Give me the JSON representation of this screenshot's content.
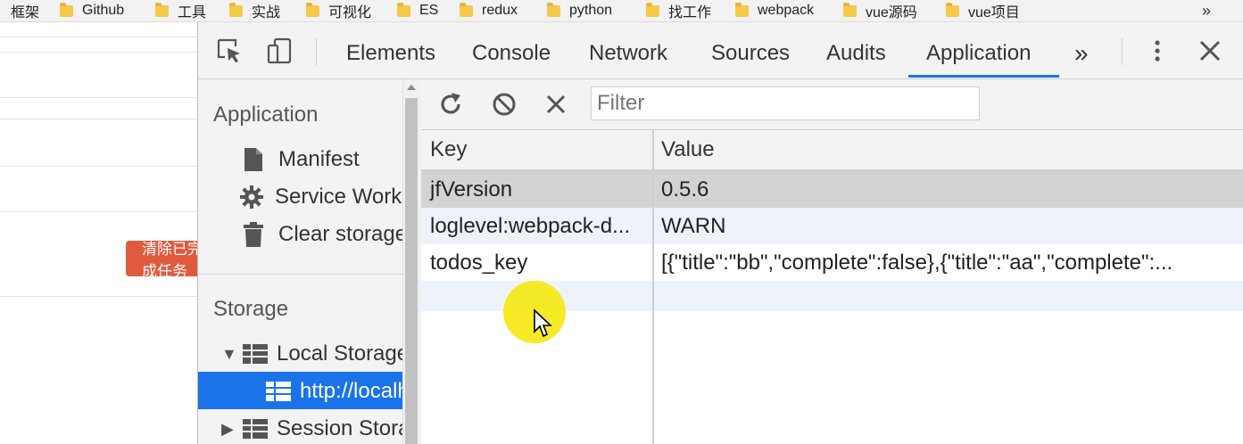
{
  "bookmarks": {
    "items": [
      {
        "label": "框架",
        "folder": false
      },
      {
        "label": "Github",
        "folder": true
      },
      {
        "label": "工具",
        "folder": true
      },
      {
        "label": "实战",
        "folder": true
      },
      {
        "label": "可视化",
        "folder": true
      },
      {
        "label": "ES",
        "folder": true
      },
      {
        "label": "redux",
        "folder": true
      },
      {
        "label": "python",
        "folder": true
      },
      {
        "label": "找工作",
        "folder": true
      },
      {
        "label": "webpack",
        "folder": true
      },
      {
        "label": "vue源码",
        "folder": true
      },
      {
        "label": "vue项目",
        "folder": true
      }
    ],
    "more": "»"
  },
  "page": {
    "button_label": "清除已完成任务"
  },
  "devtools": {
    "tabs": [
      "Elements",
      "Console",
      "Network",
      "Sources",
      "Audits",
      "Application"
    ],
    "active_tab": "Application",
    "overflow": "»",
    "menu_icon": "kebab-menu-icon",
    "close_icon": "close-icon",
    "accent": "#1a73e8"
  },
  "sidebar": {
    "application_section": "Application",
    "application_items": [
      {
        "label": "Manifest",
        "icon": "file-icon"
      },
      {
        "label": "Service Workers",
        "icon": "gear-icon"
      },
      {
        "label": "Clear storage",
        "icon": "trash-icon"
      }
    ],
    "storage_section": "Storage",
    "storage_items": [
      {
        "label": "Local Storage",
        "icon": "grid-icon",
        "expanded": true
      },
      {
        "label": "http://localhost",
        "icon": "grid-icon",
        "selected": true
      },
      {
        "label": "Session Storage",
        "icon": "grid-icon",
        "expanded": false
      }
    ]
  },
  "storage_view": {
    "filter_placeholder": "Filter",
    "columns": [
      "Key",
      "Value"
    ],
    "rows": [
      {
        "key": "jfVersion",
        "value": "0.5.6",
        "selected": true
      },
      {
        "key": "loglevel:webpack-d...",
        "value": "WARN"
      },
      {
        "key": "todos_key",
        "value": "[{\"title\":\"bb\",\"complete\":false},{\"title\":\"aa\",\"complete\":..."
      }
    ]
  }
}
